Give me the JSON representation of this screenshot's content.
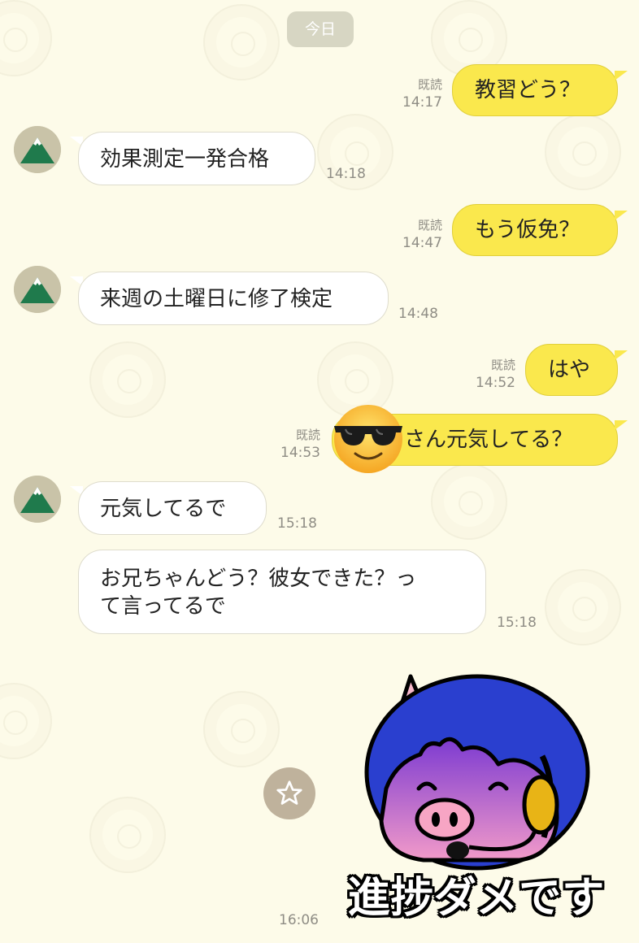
{
  "chat": {
    "date_label": "今日",
    "read_label": "既読",
    "messages": [
      {
        "id": "m1",
        "direction": "out",
        "lines": [
          "教習どう？"
        ],
        "read": "既読",
        "time": "14:17"
      },
      {
        "id": "m2",
        "direction": "in",
        "lines": [
          "効果測定一発合格"
        ],
        "time": "14:18"
      },
      {
        "id": "m3",
        "direction": "out",
        "lines": [
          "もう仮免？"
        ],
        "read": "既読",
        "time": "14:47"
      },
      {
        "id": "m4",
        "direction": "in",
        "lines": [
          "来週の土曜日に修了検定"
        ],
        "time": "14:48"
      },
      {
        "id": "m5",
        "direction": "out",
        "lines": [
          "はや"
        ],
        "read": "既読",
        "time": "14:52"
      },
      {
        "id": "m6",
        "direction": "out",
        "lines": [
          "さん元気してる？"
        ],
        "read": "既読",
        "time": "14:53"
      },
      {
        "id": "m7",
        "direction": "in",
        "lines": [
          "元気してるで"
        ],
        "time": "15:18"
      },
      {
        "id": "m8",
        "direction": "in",
        "lines": [
          "お兄ちゃんどう？彼女できた？っ",
          "て言ってるで"
        ],
        "time": "15:18"
      }
    ],
    "sticker": {
      "caption": "進捗ダメです",
      "time": "16:06"
    }
  },
  "icons": {
    "avatar": "mountain-avatar-icon",
    "emoji": "sunglasses-emoji-icon",
    "favorite": "star-icon"
  },
  "colors": {
    "background": "#fdfbe9",
    "outgoing_bubble": "#fae84d",
    "incoming_bubble": "#ffffff",
    "meta_text": "#8f8d85",
    "date_pill": "#d7d6c3",
    "star_button": "#bfb29c"
  }
}
